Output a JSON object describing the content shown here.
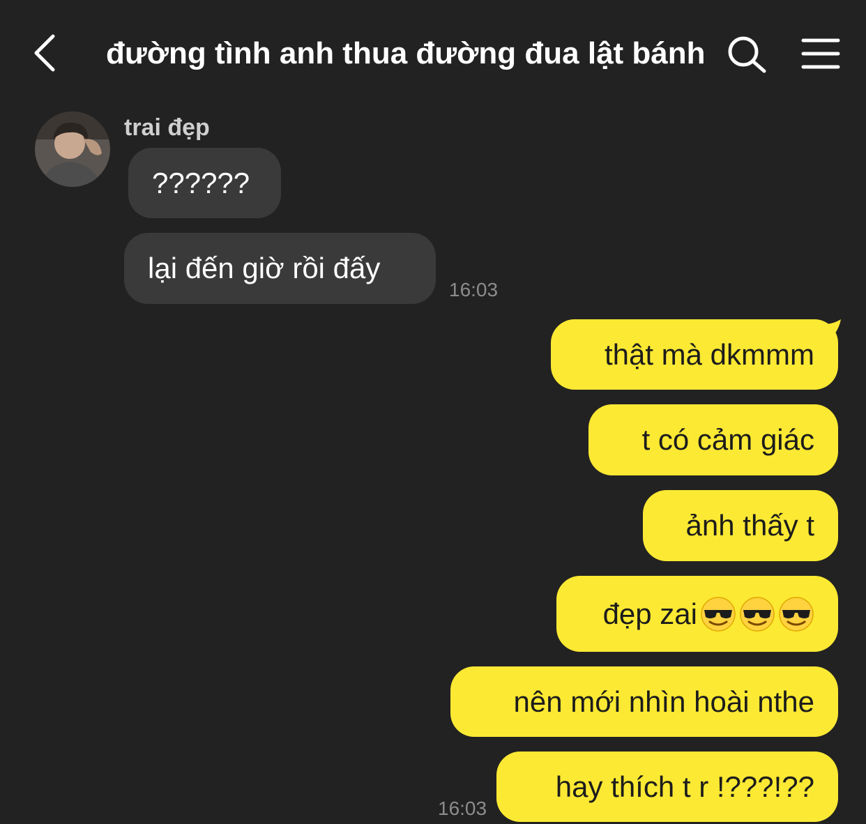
{
  "header": {
    "title": "đường tình anh thua đường đua lật bánh",
    "back_icon": "chevron-left-icon",
    "search_icon": "search-icon",
    "menu_icon": "hamburger-menu-icon"
  },
  "sender": {
    "name": "trai đẹp"
  },
  "incoming": [
    {
      "text": "??????"
    },
    {
      "text": "lại đến giờ rồi đấy"
    }
  ],
  "incoming_time": "16:03",
  "outgoing": [
    {
      "text": "thật mà dkmmm"
    },
    {
      "text": "t có cảm giác"
    },
    {
      "text": "ảnh thấy t"
    },
    {
      "text": "đẹp zai"
    },
    {
      "text": "nên mới nhìn hoài nthe"
    },
    {
      "text": "hay thích t r !???!??"
    }
  ],
  "outgoing_time": "16:03",
  "emoji_after_dep_zai": "sunglasses-face-icon",
  "colors": {
    "background": "#222222",
    "incoming_bubble": "#3a3a3a",
    "outgoing_bubble": "#fce933",
    "timestamp": "#8c8c8c"
  }
}
